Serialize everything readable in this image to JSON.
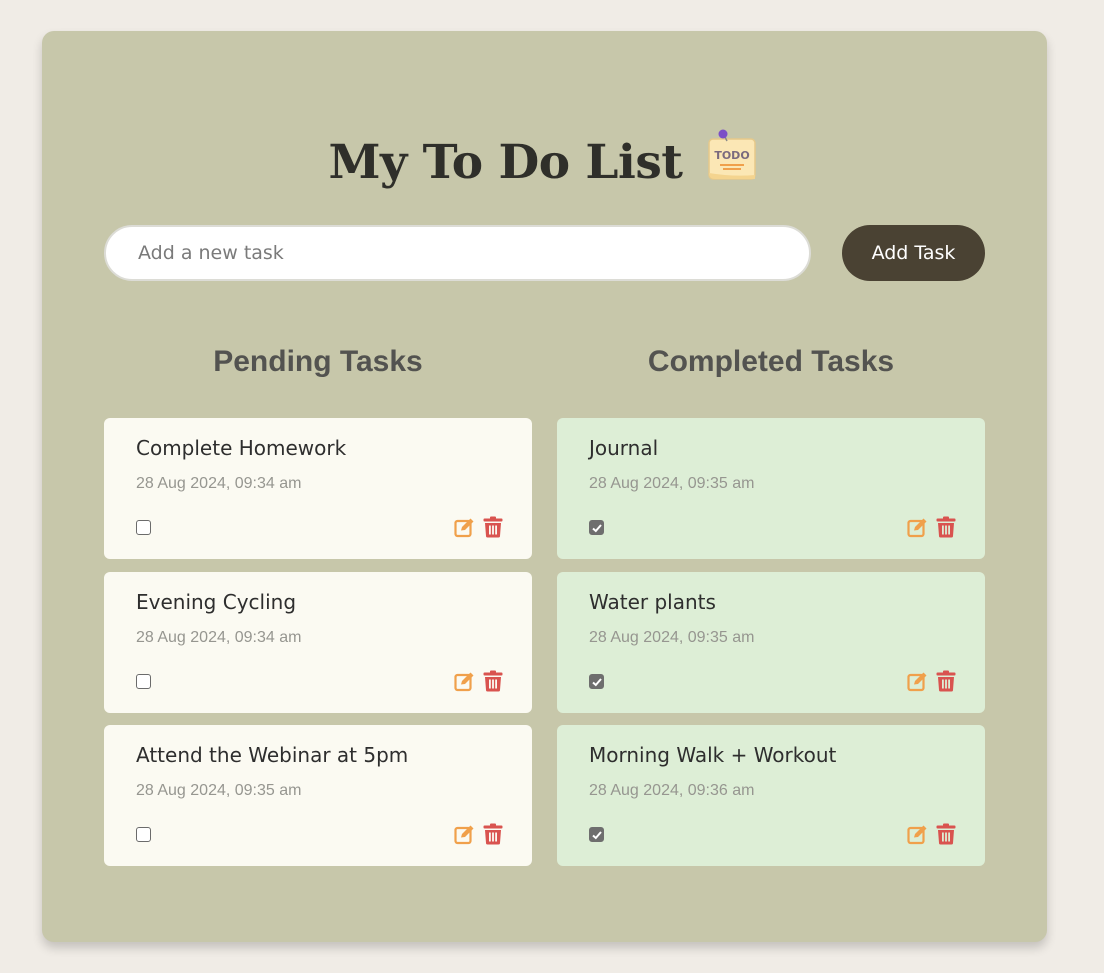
{
  "app": {
    "title": "My To Do List"
  },
  "input": {
    "placeholder": "Add a new task",
    "value": ""
  },
  "add_button_label": "Add Task",
  "pending": {
    "heading": "Pending Tasks",
    "tasks": [
      {
        "name": "Complete Homework",
        "date": "28 Aug 2024, 09:34 am",
        "done": false
      },
      {
        "name": "Evening Cycling",
        "date": "28 Aug 2024, 09:34 am",
        "done": false
      },
      {
        "name": "Attend the Webinar at 5pm",
        "date": "28 Aug 2024, 09:35 am",
        "done": false
      }
    ]
  },
  "completed": {
    "heading": "Completed Tasks",
    "tasks": [
      {
        "name": "Journal",
        "date": "28 Aug 2024, 09:35 am",
        "done": true
      },
      {
        "name": "Water plants",
        "date": "28 Aug 2024, 09:35 am",
        "done": true
      },
      {
        "name": "Morning Walk + Workout",
        "date": "28 Aug 2024, 09:36 am",
        "done": true
      }
    ]
  },
  "icons": {
    "title_icon": "todo-note-icon",
    "edit": "edit-icon",
    "delete": "trash-icon",
    "checkbox": "checkbox-icon"
  },
  "colors": {
    "page_background": "#f0ece6",
    "card_background": "#c7c7aa",
    "add_button": "#4a4233",
    "pending_card": "#fbfaf2",
    "completed_card": "#ddeed6",
    "edit_icon": "#f0a04b",
    "delete_icon": "#d9534f"
  }
}
